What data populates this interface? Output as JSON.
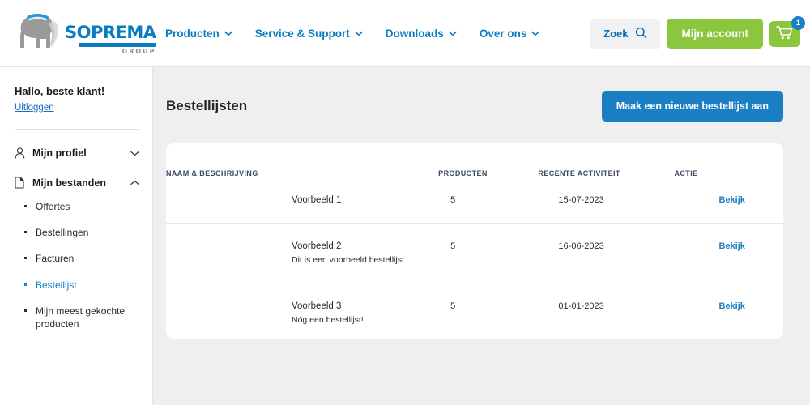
{
  "header": {
    "logo": {
      "brand": "SOPREMA",
      "sub": "GROUP",
      "icon": "elephant-logo"
    },
    "nav": [
      {
        "label": "Producten",
        "icon": "chevron-down-icon"
      },
      {
        "label": "Service & Support",
        "icon": "chevron-down-icon"
      },
      {
        "label": "Downloads",
        "icon": "chevron-down-icon"
      },
      {
        "label": "Over ons",
        "icon": "chevron-down-icon"
      }
    ],
    "search_label": "Zoek",
    "search_icon": "search-icon",
    "account_label": "Mijn account",
    "cart_icon": "shopping-cart-icon",
    "cart_count": "1",
    "accent_blue": "#0a7dc1",
    "accent_green": "#8cc63e"
  },
  "sidebar": {
    "greeting": "Hallo, beste klant!",
    "logout_label": "Uitloggen",
    "groups": [
      {
        "label": "Mijn profiel",
        "icon": "user-icon",
        "arrow": "chevron-down-icon",
        "expanded": false
      },
      {
        "label": "Mijn bestanden",
        "icon": "document-icon",
        "arrow": "chevron-up-icon",
        "expanded": true
      }
    ],
    "subitems": [
      {
        "label": "Offertes",
        "active": false
      },
      {
        "label": "Bestellingen",
        "active": false
      },
      {
        "label": "Facturen",
        "active": false
      },
      {
        "label": "Bestellijst",
        "active": true
      },
      {
        "label": "Mijn meest gekochte producten",
        "active": false
      }
    ]
  },
  "main": {
    "title": "Bestellijsten",
    "new_list_button": "Maak een nieuwe bestellijst aan",
    "table": {
      "columns": [
        "NAAM & BESCHRIJVING",
        "PRODUCTEN",
        "RECENTE ACTIVITEIT",
        "ACTIE"
      ],
      "rows": [
        {
          "name": "Voorbeeld 1",
          "description": "",
          "products": "5",
          "activity": "15-07-2023",
          "action": "Bekijk"
        },
        {
          "name": "Voorbeeld 2",
          "description": "Dit is een voorbeeld bestellijst",
          "products": "5",
          "activity": "16-06-2023",
          "action": "Bekijk"
        },
        {
          "name": "Voorbeeld 3",
          "description": "Nóg een bestellijst!",
          "products": "5",
          "activity": "01-01-2023",
          "action": "Bekijk"
        }
      ]
    }
  }
}
